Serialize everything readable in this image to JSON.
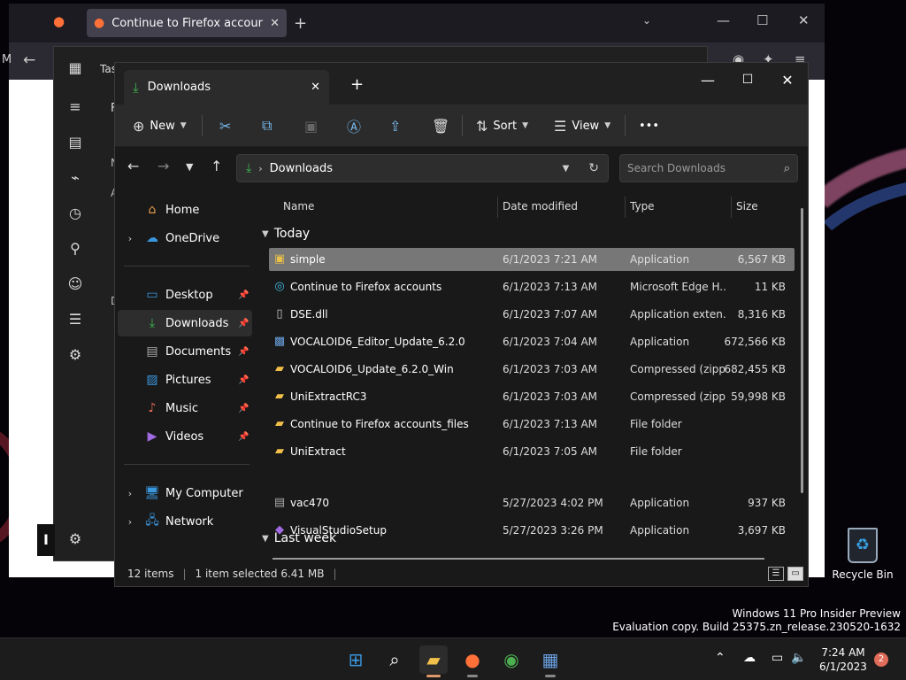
{
  "firefox": {
    "tab_title": "Continue to Firefox accounts",
    "nav_letter": "M"
  },
  "task_manager": {
    "title_partial": "Tas",
    "side_partial_1": "F",
    "side_partial_2": "N",
    "side_partial_3": "A",
    "side_partial_4": "D"
  },
  "explorer": {
    "tab_title": "Downloads",
    "toolbar": {
      "new_label": "New",
      "sort_label": "Sort",
      "view_label": "View",
      "more_label": "•••"
    },
    "address": {
      "path": "Downloads",
      "search_placeholder": "Search Downloads"
    },
    "nav": [
      {
        "label": "Home",
        "icon": "home-icon"
      },
      {
        "label": "OneDrive",
        "icon": "cloud-icon"
      },
      {
        "label": "Desktop",
        "icon": "desktop-icon"
      },
      {
        "label": "Downloads",
        "icon": "download-icon"
      },
      {
        "label": "Documents",
        "icon": "document-icon"
      },
      {
        "label": "Pictures",
        "icon": "picture-icon"
      },
      {
        "label": "Music",
        "icon": "music-icon"
      },
      {
        "label": "Videos",
        "icon": "video-icon"
      },
      {
        "label": "My Computer",
        "icon": "computer-icon"
      },
      {
        "label": "Network",
        "icon": "network-icon"
      }
    ],
    "columns": {
      "name": "Name",
      "date": "Date modified",
      "type": "Type",
      "size": "Size"
    },
    "groups": {
      "today": "Today",
      "last_week": "Last week"
    },
    "files": [
      {
        "name": "simple",
        "date": "6/1/2023 7:21 AM",
        "type": "Application",
        "size": "6,567 KB"
      },
      {
        "name": "Continue to Firefox accounts",
        "date": "6/1/2023 7:13 AM",
        "type": "Microsoft Edge H...",
        "size": "11 KB"
      },
      {
        "name": "DSE.dll",
        "date": "6/1/2023 7:07 AM",
        "type": "Application exten...",
        "size": "8,316 KB"
      },
      {
        "name": "VOCALOID6_Editor_Update_6.2.0",
        "date": "6/1/2023 7:04 AM",
        "type": "Application",
        "size": "672,566 KB"
      },
      {
        "name": "VOCALOID6_Update_6.2.0_Win",
        "date": "6/1/2023 7:03 AM",
        "type": "Compressed (zipp...",
        "size": "682,455 KB"
      },
      {
        "name": "UniExtractRC3",
        "date": "6/1/2023 7:03 AM",
        "type": "Compressed (zipp...",
        "size": "59,998 KB"
      },
      {
        "name": "Continue to Firefox accounts_files",
        "date": "6/1/2023 7:13 AM",
        "type": "File folder",
        "size": ""
      },
      {
        "name": "UniExtract",
        "date": "6/1/2023 7:05 AM",
        "type": "File folder",
        "size": ""
      },
      {
        "name": "vac470",
        "date": "5/27/2023 4:02 PM",
        "type": "Application",
        "size": "937 KB"
      },
      {
        "name": "VisualStudioSetup",
        "date": "5/27/2023 3:26 PM",
        "type": "Application",
        "size": "3,697 KB"
      }
    ],
    "status": {
      "items": "12 items",
      "selected": "1 item selected  6.41 MB"
    }
  },
  "desktop": {
    "recycle_bin": "Recycle Bin",
    "watermark_line1": "Windows 11 Pro Insider Preview",
    "watermark_line2": "Evaluation copy. Build 25375.zn_release.230520-1632",
    "partial_letter": "I"
  },
  "taskbar": {
    "time": "7:24 AM",
    "date": "6/1/2023",
    "notification_count": "2"
  }
}
